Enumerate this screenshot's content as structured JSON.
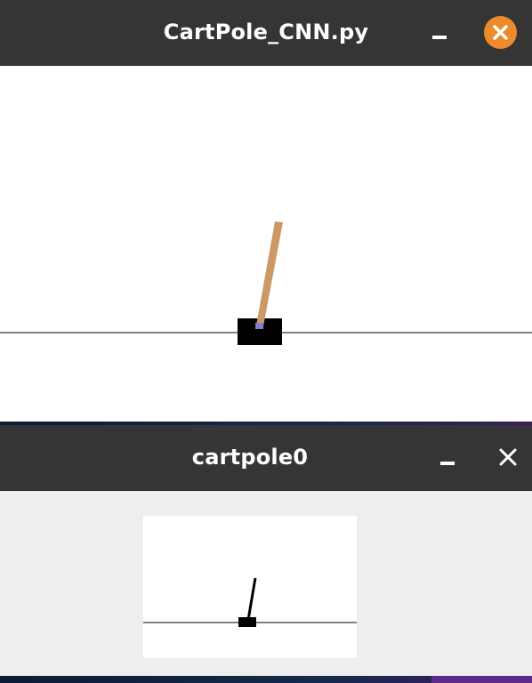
{
  "windows": [
    {
      "title": "CartPole_CNN.py",
      "controls": {
        "minimize": "minimize-icon",
        "close": "close-icon"
      },
      "close_color": "#ec8a2c",
      "pole_color": "#cc9966",
      "axle_color": "#8080cc",
      "cart_color": "#000000"
    },
    {
      "title": "cartpole0",
      "controls": {
        "minimize": "minimize-icon",
        "close": "close-icon"
      },
      "background": "#eeeeee"
    }
  ]
}
